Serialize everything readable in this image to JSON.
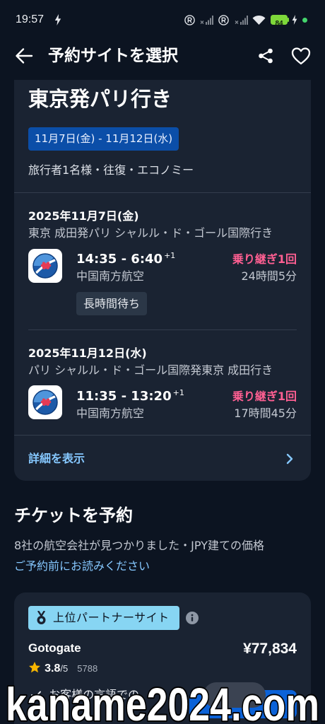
{
  "colors": {
    "background": "#0c1421",
    "card": "#1a2332",
    "divider": "#333d4d",
    "secondary_text": "#c3c8d1",
    "link": "#86c8ff",
    "stops": "#ff5f92",
    "date_pill": "#0b4ea8",
    "tag_bg": "#2b3747",
    "partner_badge": "#87d5f3",
    "star": "#f7b500",
    "primary_button": "#0b62d8",
    "battery": "#7ed83a"
  },
  "icons": {
    "status": [
      "lightning-icon",
      "roaming-r-icon",
      "signal-no-service-icon",
      "wifi-icon",
      "battery-icon",
      "charging-icon"
    ],
    "app_bar": [
      "back-arrow-icon",
      "share-icon",
      "heart-icon"
    ],
    "details": "chevron-right-icon",
    "partner": "medal-icon",
    "info": "info-icon",
    "rating": "star-icon",
    "feature": "check-icon",
    "airline_logo": "china-southern-logo"
  },
  "status_bar": {
    "time": "19:57",
    "battery_level": "84"
  },
  "app_bar": {
    "title": "予約サイトを選択"
  },
  "trip": {
    "title": "東京発パリ行き",
    "dates": "11月7日(金) - 11月12日(水)",
    "summary": "旅行者1名様・往復・エコノミー",
    "legs": [
      {
        "date": "2025年11月7日(金)",
        "route": "東京 成田発パリ シャルル・ド・ゴール国際行き",
        "times": "14:35 - 6:40",
        "day_offset": "+1",
        "airline": "中国南方航空",
        "stops": "乗り継ぎ1回",
        "duration": "24時間5分",
        "tag": "長時間待ち"
      },
      {
        "date": "2025年11月12日(水)",
        "route": "パリ シャルル・ド・ゴール国際発東京 成田行き",
        "times": "11:35 - 13:20",
        "day_offset": "+1",
        "airline": "中国南方航空",
        "stops": "乗り継ぎ1回",
        "duration": "17時間45分"
      }
    ],
    "details_link": "詳細を表示"
  },
  "booking": {
    "heading": "チケットを予約",
    "found_text": "8社の航空会社が見つかりました・JPY建ての価格",
    "read_before_link": "ご予約前にお読みください",
    "providers": [
      {
        "badge": "上位パートナーサイト",
        "name": "Gotogate",
        "price": "¥77,834",
        "rating": "3.8",
        "rating_max": "/5",
        "review_count": "5788",
        "feature": "お客様の言語での"
      }
    ]
  },
  "watermark": "kaname2024.com"
}
